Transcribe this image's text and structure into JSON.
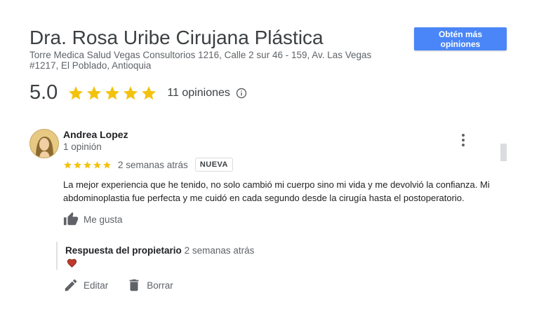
{
  "business": {
    "name": "Dra. Rosa Uribe Cirujana Plástica",
    "address": "Torre Medica Salud Vegas Consultorios 1216, Calle 2 sur 46 - 159, Av. Las Vegas #1217, El Poblado, Antioquia"
  },
  "cta": {
    "label": "Obtén más opiniones"
  },
  "summary": {
    "rating": "5.0",
    "stars": 5,
    "count_label": "11 opiniones"
  },
  "review": {
    "author": "Andrea Lopez",
    "author_meta": "1 opinión",
    "stars": 5,
    "time": "2 semanas atrás",
    "badge": "NUEVA",
    "text": "La mejor experiencia que he tenido, no solo cambió mi cuerpo sino mi vida y me devolvió la confianza. Mi abdominoplastia fue perfecta y me cuidó en cada segundo desde la cirugía hasta el postoperatorio.",
    "like_label": "Me gusta"
  },
  "reply": {
    "label": "Respuesta del propietario",
    "time": "2 semanas atrás",
    "content_icon": "heart-icon"
  },
  "actions": {
    "edit_label": "Editar",
    "delete_label": "Borrar"
  },
  "colors": {
    "accent": "#4a86f7",
    "star": "#f4c20d",
    "heart": "#c0392b"
  }
}
